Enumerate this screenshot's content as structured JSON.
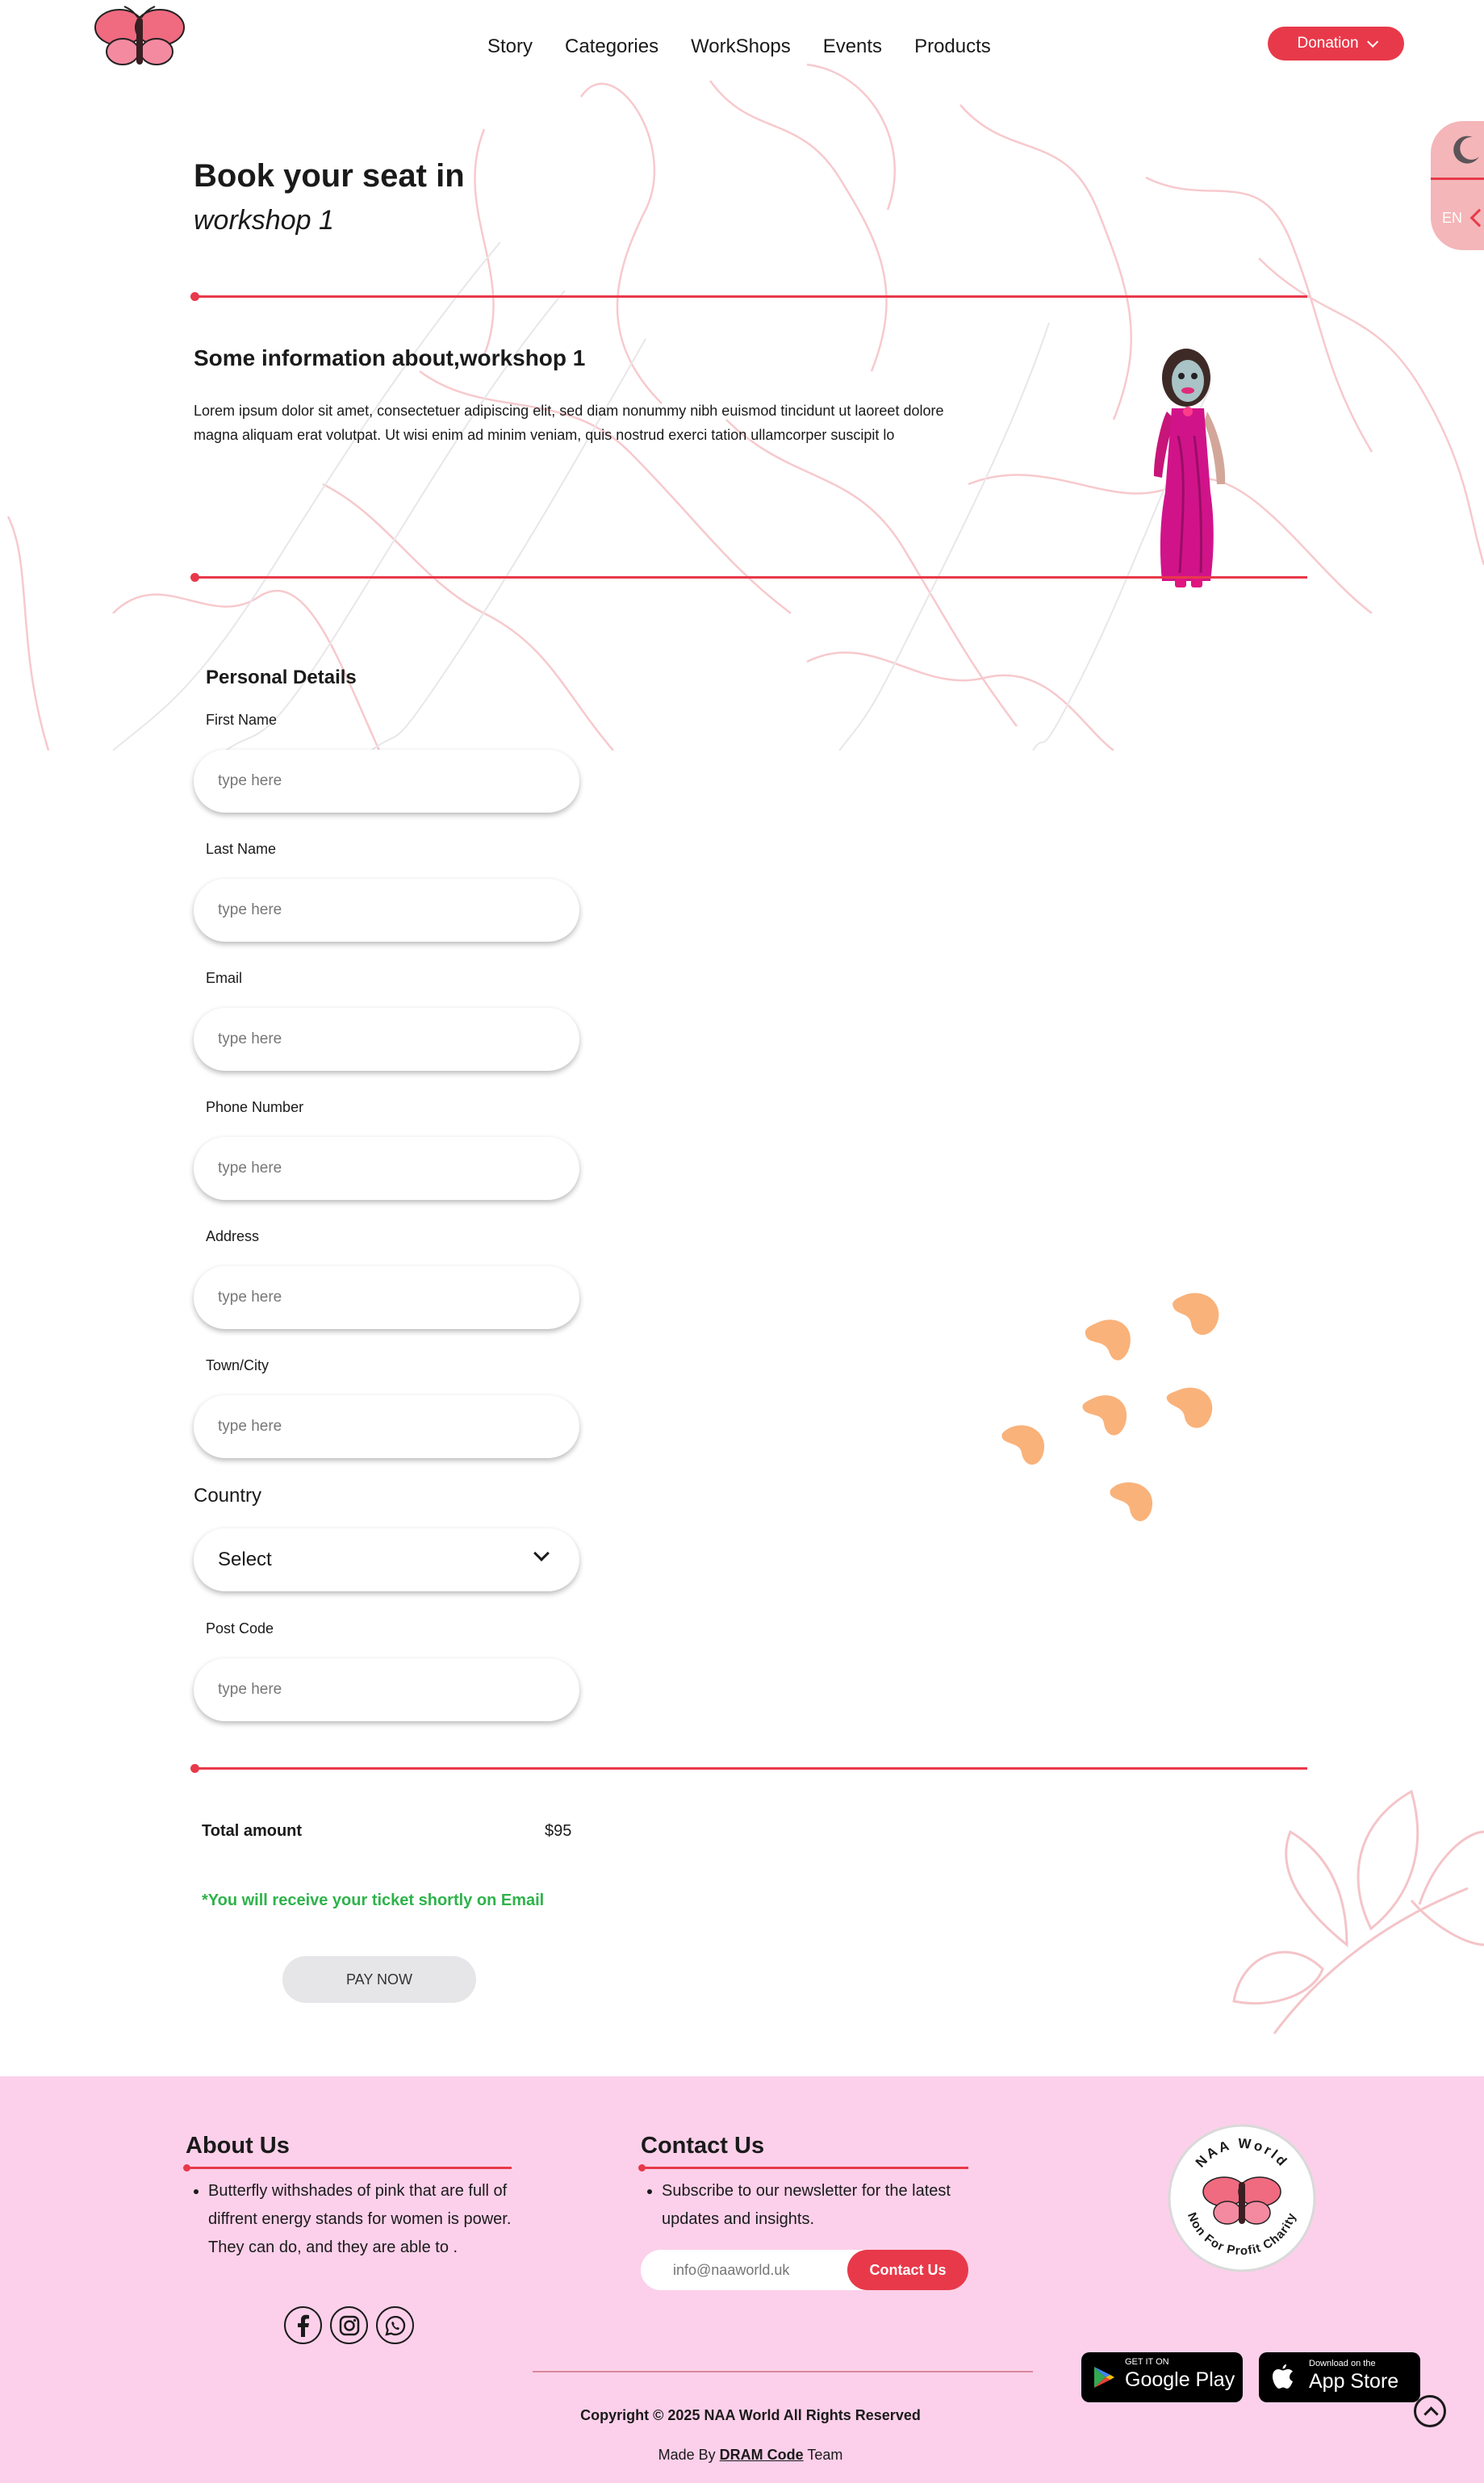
{
  "header": {
    "nav": [
      "Story",
      "Categories",
      "WorkShops",
      "Events",
      "Products"
    ],
    "donation_label": "Donation"
  },
  "side_toggle": {
    "lang": "EN"
  },
  "hero": {
    "title_line1": "Book your seat in",
    "title_line2": "workshop 1"
  },
  "info": {
    "title": "Some information about,workshop 1",
    "text": "Lorem ipsum dolor sit amet, consectetuer adipiscing elit, sed diam nonummy nibh euismod tincidunt ut laoreet dolore magna aliquam erat volutpat. Ut wisi enim ad minim veniam, quis nostrud exerci tation ullamcorper suscipit lo"
  },
  "form": {
    "section_title": "Personal Details",
    "fields": [
      {
        "label": "First Name",
        "placeholder": "type here"
      },
      {
        "label": "Last Name",
        "placeholder": "type here"
      },
      {
        "label": "Email",
        "placeholder": "type here"
      },
      {
        "label": "Phone Number",
        "placeholder": "type here"
      },
      {
        "label": "Address",
        "placeholder": "type here"
      },
      {
        "label": "Town/City",
        "placeholder": "type here"
      }
    ],
    "country_label": "Country",
    "country_selected": "Select",
    "postcode_label": "Post Code",
    "postcode_placeholder": "type here"
  },
  "summary": {
    "total_label": "Total amount",
    "total_value": "$95",
    "ticket_note": "*You will receive your ticket shortly on Email",
    "pay_label": "PAY NOW"
  },
  "footer": {
    "about_title": "About Us",
    "about_text": "Butterfly withshades of pink that are full of diffrent energy stands for women is power. They can do, and they are able to .",
    "contact_title": "Contact Us",
    "contact_text": "Subscribe to our newsletter for the latest updates and insights.",
    "email_placeholder": "info@naaworld.uk",
    "contact_button": "Contact Us",
    "seal_top": "NAA World",
    "seal_bottom": "Non For Profit Charity",
    "google_small": "GET IT ON",
    "google_big": "Google Play",
    "apple_small": "Download on the",
    "apple_big": "App Store",
    "copyright": "Copyright © 2025 NAA World All Rights Reserved",
    "made_by_prefix": "Made By",
    "made_by_link": "DRAM Code",
    "made_by_suffix": "Team"
  },
  "colors": {
    "accent": "#e8394a",
    "footer_bg": "#fcd0ea",
    "note_green": "#2eb34a",
    "blob": "#f9b27a"
  },
  "icons": [
    "butterfly-logo",
    "chevron-down-icon",
    "moon-icon",
    "facebook-icon",
    "instagram-icon",
    "whatsapp-icon",
    "google-play-icon",
    "apple-icon",
    "scroll-top-icon"
  ]
}
